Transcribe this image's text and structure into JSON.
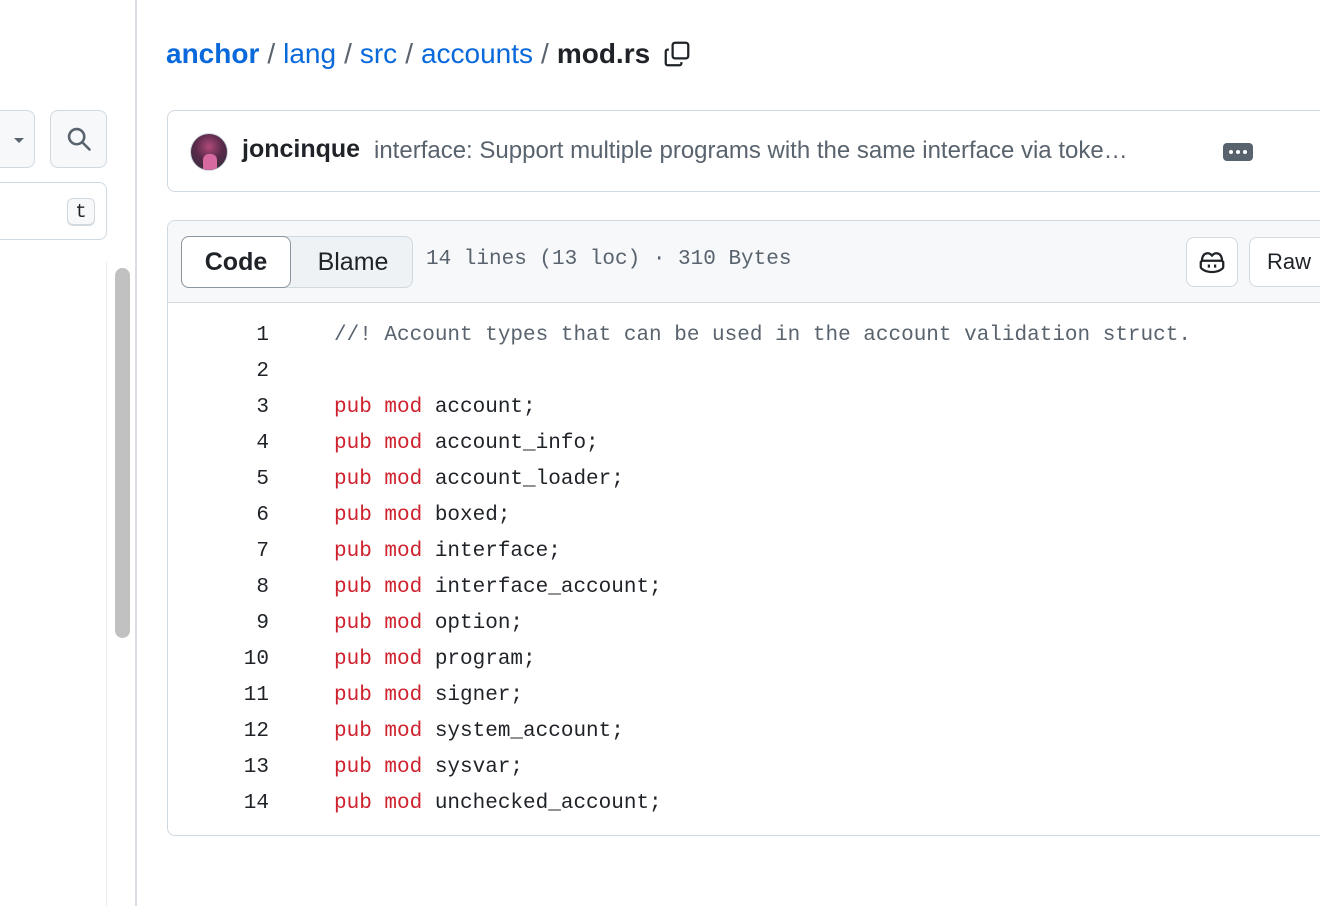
{
  "sidebar": {
    "search_icon": "search-icon",
    "filter_shortcut": "t"
  },
  "breadcrumb": {
    "repo": "anchor",
    "path": [
      "lang",
      "src",
      "accounts"
    ],
    "separator": "/",
    "current_file": "mod.rs",
    "copy_icon": "copy-icon"
  },
  "commit": {
    "author": "joncinque",
    "message": "interface: Support multiple programs with the same interface via toke…",
    "more_icon": "kebab-horizontal-icon"
  },
  "file": {
    "tabs": {
      "code": "Code",
      "blame": "Blame"
    },
    "selected_tab": "Code",
    "meta": "14 lines (13 loc) · 310 Bytes",
    "copilot_icon": "copilot-icon",
    "raw_label": "Raw"
  },
  "code_lines": [
    {
      "n": "1",
      "kw": "",
      "text": "//! Account types that can be used in the account validation struct.",
      "comment": true
    },
    {
      "n": "2",
      "kw": "",
      "text": "",
      "comment": false
    },
    {
      "n": "3",
      "kw": "pub mod",
      "text": " account;",
      "comment": false
    },
    {
      "n": "4",
      "kw": "pub mod",
      "text": " account_info;",
      "comment": false
    },
    {
      "n": "5",
      "kw": "pub mod",
      "text": " account_loader;",
      "comment": false
    },
    {
      "n": "6",
      "kw": "pub mod",
      "text": " boxed;",
      "comment": false
    },
    {
      "n": "7",
      "kw": "pub mod",
      "text": " interface;",
      "comment": false
    },
    {
      "n": "8",
      "kw": "pub mod",
      "text": " interface_account;",
      "comment": false
    },
    {
      "n": "9",
      "kw": "pub mod",
      "text": " option;",
      "comment": false
    },
    {
      "n": "10",
      "kw": "pub mod",
      "text": " program;",
      "comment": false
    },
    {
      "n": "11",
      "kw": "pub mod",
      "text": " signer;",
      "comment": false
    },
    {
      "n": "12",
      "kw": "pub mod",
      "text": " system_account;",
      "comment": false
    },
    {
      "n": "13",
      "kw": "pub mod",
      "text": " sysvar;",
      "comment": false
    },
    {
      "n": "14",
      "kw": "pub mod",
      "text": " unchecked_account;",
      "comment": false
    }
  ],
  "colors": {
    "link": "#0969da",
    "keyword": "#cf222e",
    "comment": "#59636e",
    "border": "#d1d9e0"
  }
}
